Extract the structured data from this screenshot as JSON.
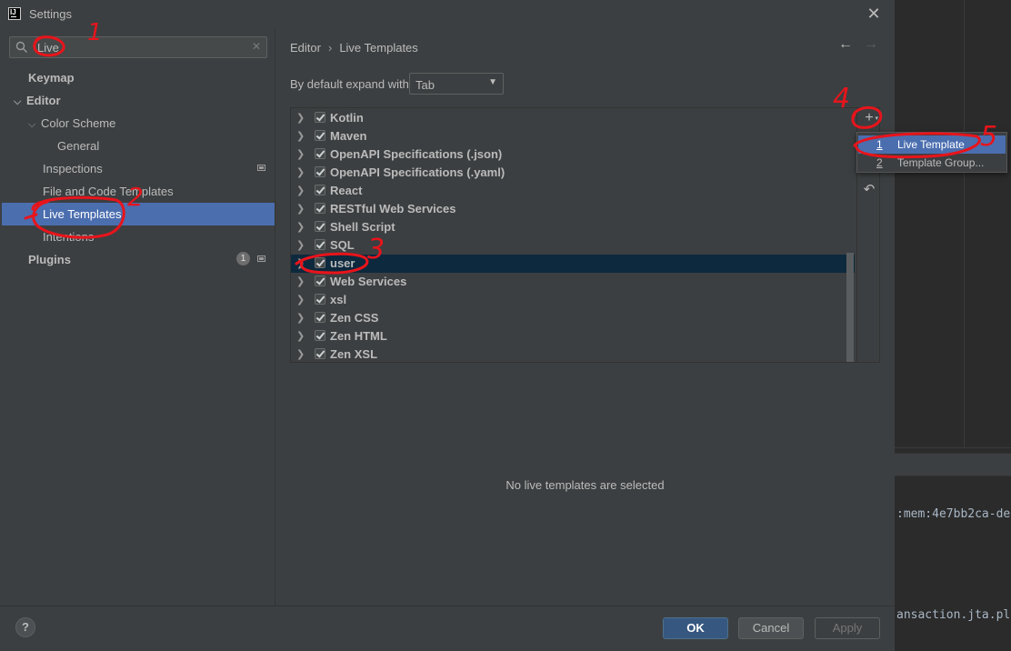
{
  "window": {
    "title": "Settings",
    "close_glyph": "✕"
  },
  "search": {
    "value": "Live",
    "clear_glyph": "✕"
  },
  "sidebar": {
    "items": [
      {
        "label": "Keymap"
      },
      {
        "label": "Editor"
      },
      {
        "label": "Color Scheme"
      },
      {
        "label": "General"
      },
      {
        "label": "Inspections"
      },
      {
        "label": "File and Code Templates"
      },
      {
        "label": "Live Templates"
      },
      {
        "label": "Intentions"
      },
      {
        "label": "Plugins"
      }
    ],
    "plugins_badge": "1"
  },
  "breadcrumb": {
    "root": "Editor",
    "sep": "›",
    "leaf": "Live Templates"
  },
  "expand": {
    "label": "By default expand with",
    "value": "Tab"
  },
  "template_groups": [
    {
      "label": "Kotlin"
    },
    {
      "label": "Maven"
    },
    {
      "label": "OpenAPI Specifications (.json)"
    },
    {
      "label": "OpenAPI Specifications (.yaml)"
    },
    {
      "label": "React"
    },
    {
      "label": "RESTful Web Services"
    },
    {
      "label": "Shell Script"
    },
    {
      "label": "SQL"
    },
    {
      "label": "user"
    },
    {
      "label": "Web Services"
    },
    {
      "label": "xsl"
    },
    {
      "label": "Zen CSS"
    },
    {
      "label": "Zen HTML"
    },
    {
      "label": "Zen XSL"
    }
  ],
  "popup": {
    "items": [
      {
        "num": "1",
        "label": "Live Template"
      },
      {
        "num": "2",
        "label": "Template Group..."
      }
    ]
  },
  "empty_message": "No live templates are selected",
  "footer": {
    "help": "?",
    "ok": "OK",
    "cancel": "Cancel",
    "apply": "Apply"
  },
  "background": {
    "line1": ":mem:4e7bb2ca-de",
    "line2": "ansaction.jta.pl"
  },
  "annotations": {
    "n1": "1",
    "n2": "2",
    "n3": "3",
    "n4": "4",
    "n5": "5"
  },
  "colors": {
    "accent": "#4b6eaf",
    "selection_dark": "#0d293e",
    "annotation": "#e8141b",
    "ok_button": "#365880"
  }
}
